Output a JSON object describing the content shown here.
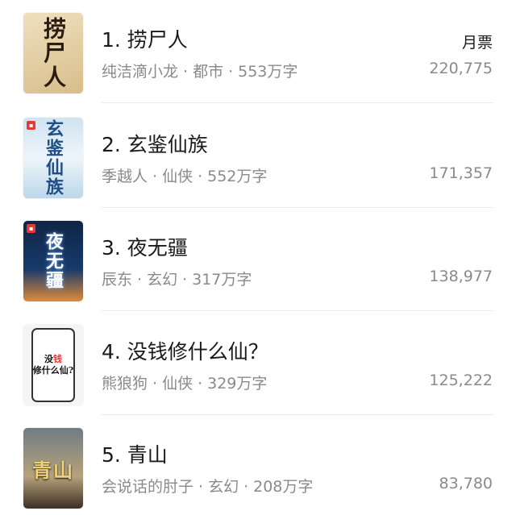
{
  "ranking": {
    "column_label": "月票",
    "items": [
      {
        "rank_title": "1. 捞尸人",
        "author": "纯洁滴小龙",
        "genre": "都市",
        "words": "553万字",
        "votes": "220,775",
        "cover_text": "捞尸人"
      },
      {
        "rank_title": "2. 玄鉴仙族",
        "author": "季越人",
        "genre": "仙侠",
        "words": "552万字",
        "votes": "171,357",
        "cover_text": "玄鉴仙族"
      },
      {
        "rank_title": "3. 夜无疆",
        "author": "辰东",
        "genre": "玄幻",
        "words": "317万字",
        "votes": "138,977",
        "cover_text": "夜无疆"
      },
      {
        "rank_title": "4. 没钱修什么仙？",
        "author": "熊狼狗",
        "genre": "仙侠",
        "words": "329万字",
        "votes": "125,222",
        "cover_text_a": "没",
        "cover_text_b": "钱",
        "cover_text_c": "修什么仙?"
      },
      {
        "rank_title": "5. 青山",
        "author": "会说话的肘子",
        "genre": "玄幻",
        "words": "208万字",
        "votes": "83,780",
        "cover_text": "青山"
      }
    ],
    "separator": "·"
  }
}
